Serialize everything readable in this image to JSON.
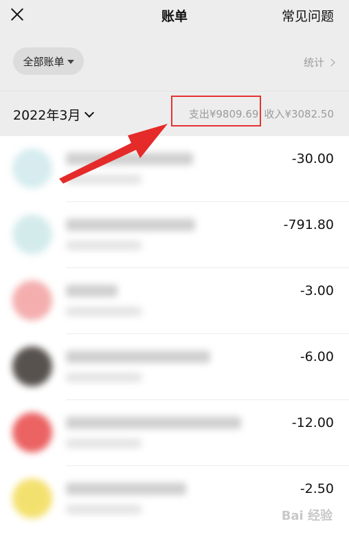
{
  "header": {
    "title": "账单",
    "faq_label": "常见问题"
  },
  "filter": {
    "chip_label": "全部账单",
    "stats_label": "统计"
  },
  "month": {
    "label": "2022年3月",
    "expense": "支出¥9809.69",
    "income": "收入¥3082.50"
  },
  "transactions": [
    {
      "amount": "-30.00",
      "avatar_color": "#cfe9ec"
    },
    {
      "amount": "-791.80",
      "avatar_color": "#cde8e9"
    },
    {
      "amount": "-3.00",
      "avatar_color": "#f3a0a0"
    },
    {
      "amount": "-6.00",
      "avatar_color": "#3a3430"
    },
    {
      "amount": "-12.00",
      "avatar_color": "#e84848"
    },
    {
      "amount": "-2.50",
      "avatar_color": "#f2dc57"
    }
  ],
  "watermark": "Bai 经验",
  "colors": {
    "highlight": "#e53131",
    "arrow": "#e52a2a"
  }
}
